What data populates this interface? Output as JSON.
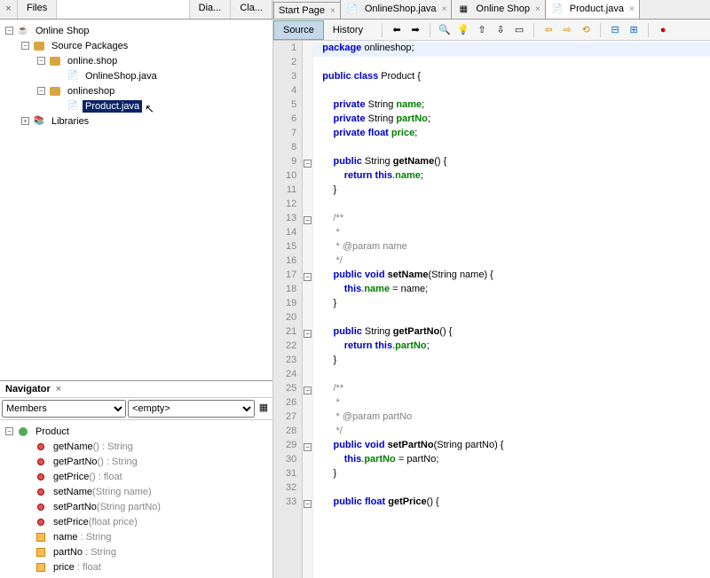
{
  "projectTabs": {
    "close": "×",
    "files": "Files",
    "dia": "Dia...",
    "cla": "Cla..."
  },
  "tree": {
    "root": "Online Shop",
    "srcPkg": "Source Packages",
    "pkg1": "online.shop",
    "file1": "OnlineShop.java",
    "pkg2": "onlineshop",
    "file2": "Product.java",
    "libs": "Libraries"
  },
  "navigator": {
    "title": "Navigator",
    "x": "×",
    "members": "Members",
    "empty": "<empty>",
    "cls": "Product",
    "m1": "getName",
    "m1sig": "() : String",
    "m2": "getPartNo",
    "m2sig": "() : String",
    "m3": "getPrice",
    "m3sig": "() : float",
    "m4": "setName",
    "m4sig": "(String name)",
    "m5": "setPartNo",
    "m5sig": "(String partNo)",
    "m6": "setPrice",
    "m6sig": "(float price)",
    "f1": "name",
    "f1t": " : String",
    "f2": "partNo",
    "f2t": " : String",
    "f3": "price",
    "f3t": " : float"
  },
  "editorTabs": {
    "t1": "Start Page",
    "t2": "OnlineShop.java",
    "t3": "Online Shop",
    "t4": "Product.java",
    "x": "×"
  },
  "subTabs": {
    "source": "Source",
    "history": "History"
  },
  "code": {
    "lines": [
      {
        "n": 1,
        "hl": true,
        "h": "<span class='kw'>package</span> onlineshop;"
      },
      {
        "n": 2,
        "h": ""
      },
      {
        "n": 3,
        "h": "<span class='kw'>public</span> <span class='kw'>class</span> Product {"
      },
      {
        "n": 4,
        "h": ""
      },
      {
        "n": 5,
        "h": "    <span class='kw'>private</span> String <span class='fld'>name</span>;"
      },
      {
        "n": 6,
        "h": "    <span class='kw'>private</span> String <span class='fld'>partNo</span>;"
      },
      {
        "n": 7,
        "h": "    <span class='kw'>private</span> <span class='kw'>float</span> <span class='fld'>price</span>;"
      },
      {
        "n": 8,
        "h": ""
      },
      {
        "n": 9,
        "fold": true,
        "h": "    <span class='kw'>public</span> String <b>getName</b>() {"
      },
      {
        "n": 10,
        "h": "        <span class='kw'>return</span> <span class='kw'>this</span>.<span class='fld'>name</span>;"
      },
      {
        "n": 11,
        "h": "    }"
      },
      {
        "n": 12,
        "h": ""
      },
      {
        "n": 13,
        "fold": true,
        "h": "    <span class='com'>/**</span>"
      },
      {
        "n": 14,
        "h": "<span class='com'>     *</span>"
      },
      {
        "n": 15,
        "h": "<span class='com'>     * @param name</span>"
      },
      {
        "n": 16,
        "h": "<span class='com'>     */</span>"
      },
      {
        "n": 17,
        "fold": true,
        "h": "    <span class='kw'>public</span> <span class='kw'>void</span> <b>setName</b>(String name) {"
      },
      {
        "n": 18,
        "h": "        <span class='kw'>this</span>.<span class='fld'>name</span> = name;"
      },
      {
        "n": 19,
        "h": "    }"
      },
      {
        "n": 20,
        "h": ""
      },
      {
        "n": 21,
        "fold": true,
        "h": "    <span class='kw'>public</span> String <b>getPartNo</b>() {"
      },
      {
        "n": 22,
        "h": "        <span class='kw'>return</span> <span class='kw'>this</span>.<span class='fld'>partNo</span>;"
      },
      {
        "n": 23,
        "h": "    }"
      },
      {
        "n": 24,
        "h": ""
      },
      {
        "n": 25,
        "fold": true,
        "h": "    <span class='com'>/**</span>"
      },
      {
        "n": 26,
        "h": "<span class='com'>     *</span>"
      },
      {
        "n": 27,
        "h": "<span class='com'>     * @param partNo</span>"
      },
      {
        "n": 28,
        "h": "<span class='com'>     */</span>"
      },
      {
        "n": 29,
        "fold": true,
        "h": "    <span class='kw'>public</span> <span class='kw'>void</span> <b>setPartNo</b>(String partNo) {"
      },
      {
        "n": 30,
        "h": "        <span class='kw'>this</span>.<span class='fld'>partNo</span> = partNo;"
      },
      {
        "n": 31,
        "h": "    }"
      },
      {
        "n": 32,
        "h": ""
      },
      {
        "n": 33,
        "fold": true,
        "h": "    <span class='kw'>public</span> <span class='kw'>float</span> <b>getPrice</b>() {"
      }
    ]
  }
}
